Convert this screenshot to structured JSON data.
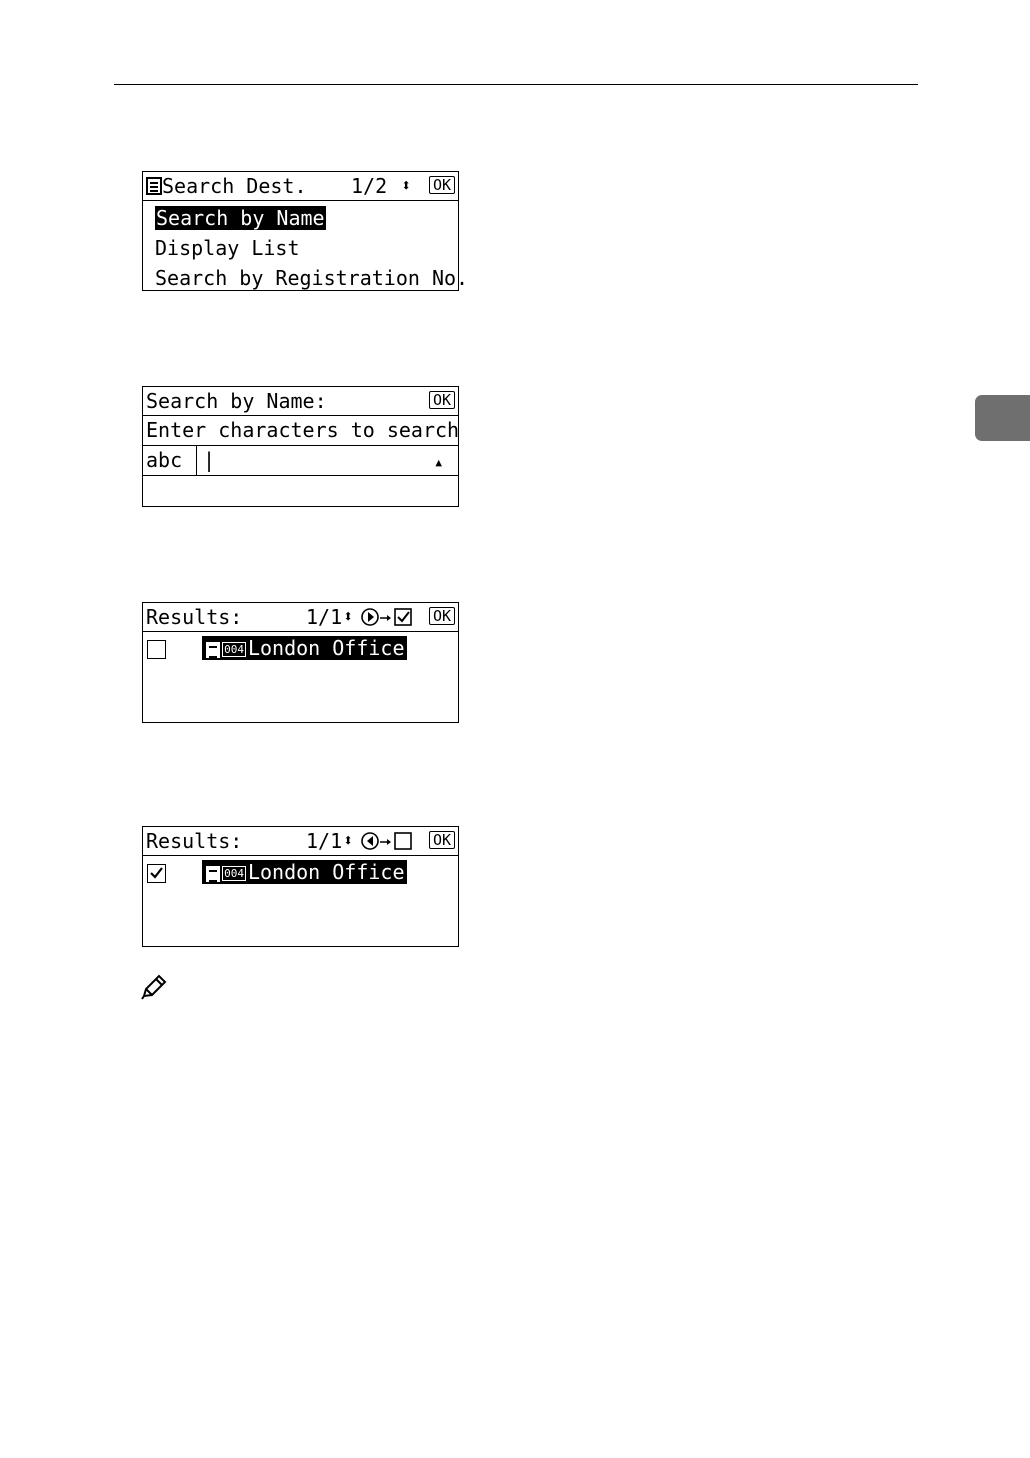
{
  "screen1": {
    "title": "Search Dest.",
    "page": "1/2",
    "ok_label": "OK",
    "items": [
      "Search by Name",
      "Display List",
      "Search by Registration No."
    ]
  },
  "screen2": {
    "title": "Search by Name:",
    "ok_label": "OK",
    "prompt": "Enter characters to search",
    "mode": "abc",
    "cursor": "|",
    "arrow": "▲"
  },
  "screen3": {
    "title": "Results:",
    "page": "1/1",
    "ok_label": "OK",
    "entry_number": "004",
    "entry_name": "London Office",
    "checked": false
  },
  "screen4": {
    "title": "Results:",
    "page": "1/1",
    "ok_label": "OK",
    "entry_number": "004",
    "entry_name": "London Office",
    "checked": true
  }
}
